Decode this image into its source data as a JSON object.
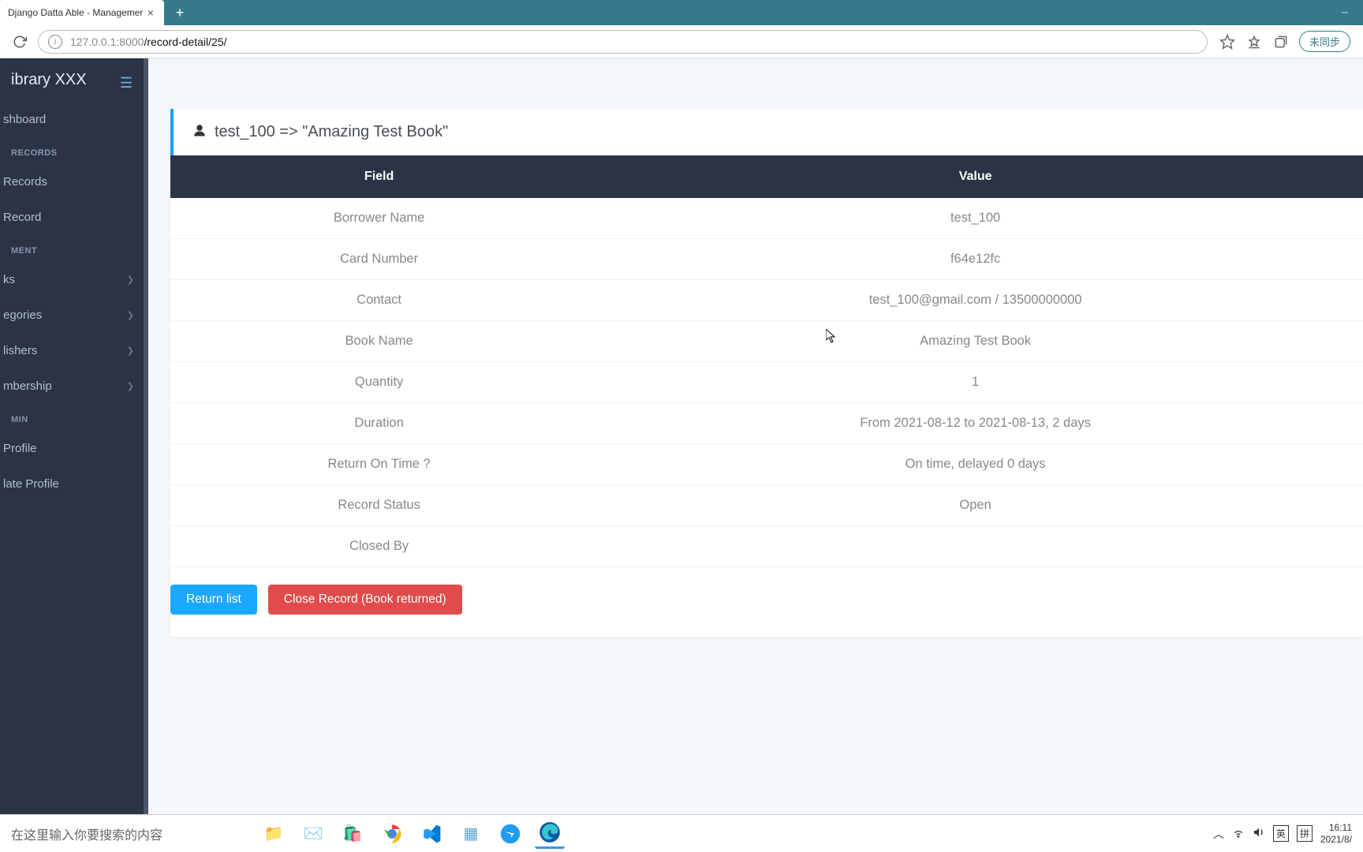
{
  "browser": {
    "tab_title": "Django Datta Able - Managemer",
    "url_host": "127.0.0.1",
    "url_port": ":8000",
    "url_path": "/record-detail/25/",
    "sync_label": "未同步"
  },
  "sidebar": {
    "brand": "ibrary XXX",
    "items": [
      {
        "label": "shboard"
      },
      {
        "header": "RECORDS"
      },
      {
        "label": "Records"
      },
      {
        "label": "Record"
      },
      {
        "header": "MENT"
      },
      {
        "label": "ks",
        "expandable": true
      },
      {
        "label": "egories",
        "expandable": true
      },
      {
        "label": "lishers",
        "expandable": true
      },
      {
        "label": "mbership",
        "expandable": true
      },
      {
        "header": "MIN"
      },
      {
        "label": "Profile"
      },
      {
        "label": "late Profile"
      }
    ]
  },
  "card": {
    "title": "test_100 => \"Amazing Test Book\""
  },
  "table": {
    "head_field": "Field",
    "head_value": "Value",
    "rows": [
      {
        "field": "Borrower Name",
        "value": "test_100"
      },
      {
        "field": "Card Number",
        "value": "f64e12fc"
      },
      {
        "field": "Contact",
        "value": "test_100@gmail.com / 13500000000"
      },
      {
        "field": "Book Name",
        "value": "Amazing Test Book"
      },
      {
        "field": "Quantity",
        "value": "1"
      },
      {
        "field": "Duration",
        "value": "From 2021-08-12 to 2021-08-13, 2 days"
      },
      {
        "field": "Return On Time ?",
        "value": "On time, delayed 0 days"
      },
      {
        "field": "Record Status",
        "value": "Open"
      },
      {
        "field": "Closed By",
        "value": ""
      }
    ]
  },
  "actions": {
    "return_list": "Return list",
    "close_record": "Close Record (Book returned)"
  },
  "taskbar": {
    "search_placeholder": "在这里输入你要搜索的内容",
    "clock_time": "16:11",
    "clock_date": "2021/8/",
    "ime1": "英",
    "ime2": "拼"
  }
}
